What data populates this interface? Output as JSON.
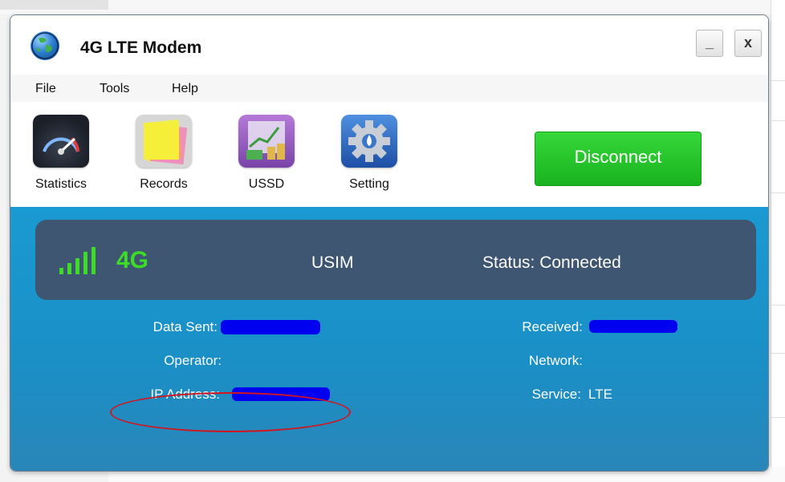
{
  "window": {
    "title": "4G LTE Modem",
    "minimize_label": "_",
    "close_label": "x"
  },
  "menu": {
    "items": [
      "File",
      "Tools",
      "Help"
    ]
  },
  "toolbar": {
    "items": [
      {
        "label": "Statistics",
        "icon": "speedometer-icon"
      },
      {
        "label": "Records",
        "icon": "sticky-note-icon"
      },
      {
        "label": "USSD",
        "icon": "money-chart-icon"
      },
      {
        "label": "Setting",
        "icon": "gear-icon"
      }
    ],
    "disconnect_label": "Disconnect"
  },
  "status": {
    "network_type": "4G",
    "sim": "USIM",
    "status_text": "Status: Connected"
  },
  "info": {
    "data_sent_label": "Data Sent:",
    "received_label": "Received:",
    "operator_label": "Operator:",
    "network_label": "Network:",
    "ip_address_label": "IP Address:",
    "service_label": "Service:",
    "service_value": "LTE"
  },
  "colors": {
    "accent_green": "#3ddc27",
    "disconnect_green": "#1ab21f",
    "content_blue": "#1a9ad2",
    "panel_navy": "#3e5672",
    "redaction_blue": "#0000f0",
    "annotation_red": "#d2151c"
  }
}
